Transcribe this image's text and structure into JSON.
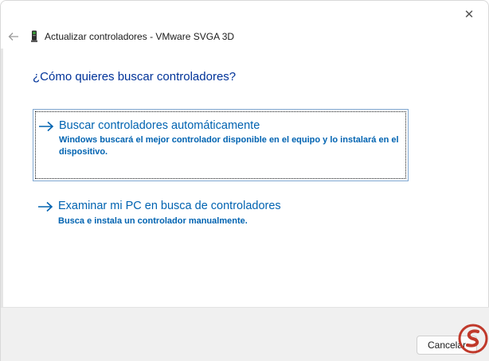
{
  "window": {
    "title": "Actualizar controladores - VMware SVGA 3D",
    "close_glyph": "✕"
  },
  "question": "¿Cómo quieres buscar controladores?",
  "options": [
    {
      "title": "Buscar controladores automáticamente",
      "description": "Windows buscará el mejor controlador disponible en el equipo y lo instalará en el dispositivo.",
      "selected": true
    },
    {
      "title": "Examinar mi PC en busca de controladores",
      "description": "Busca e instala un controlador manualmente.",
      "selected": false
    }
  ],
  "footer": {
    "cancel_label": "Cancelar"
  },
  "icons": {
    "back": "back-arrow-icon",
    "device": "graphics-card-icon",
    "option_arrow": "right-arrow-icon",
    "close": "close-icon"
  },
  "colors": {
    "heading": "#003399",
    "link": "#0063b1",
    "focus_border": "#7fa7d1",
    "footer_bg": "#f0f0f0",
    "watermark": "#c0392b"
  }
}
